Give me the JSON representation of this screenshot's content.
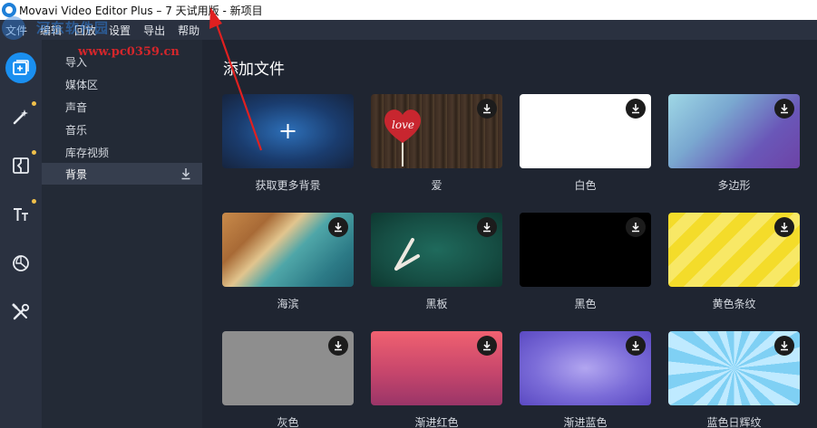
{
  "window": {
    "title": "Movavi Video Editor Plus – 7 天试用版 - 新项目"
  },
  "menu": {
    "items": [
      "文件",
      "编辑",
      "回放",
      "设置",
      "导出",
      "帮助"
    ]
  },
  "watermark": {
    "name": "河东软件园",
    "url": "www.pc0359.cn"
  },
  "rail": {
    "items": [
      {
        "icon": "add-media-icon",
        "active": true
      },
      {
        "icon": "magic-wand-icon",
        "dot": true
      },
      {
        "icon": "transitions-icon",
        "dot": true
      },
      {
        "icon": "titles-icon",
        "dot": true
      },
      {
        "icon": "stickers-icon"
      },
      {
        "icon": "tools-icon"
      }
    ]
  },
  "categories": {
    "items": [
      "导入",
      "媒体区",
      "声音",
      "音乐",
      "库存视频",
      "背景"
    ],
    "selected": "背景"
  },
  "main": {
    "title": "添加文件",
    "tiles": [
      {
        "label": "获取更多背景",
        "thumb": "more"
      },
      {
        "label": "爱",
        "thumb": "love"
      },
      {
        "label": "白色",
        "thumb": "white"
      },
      {
        "label": "多边形",
        "thumb": "poly"
      },
      {
        "label": "海滨",
        "thumb": "beach"
      },
      {
        "label": "黑板",
        "thumb": "chalk"
      },
      {
        "label": "黑色",
        "thumb": "black"
      },
      {
        "label": "黄色条纹",
        "thumb": "yellow"
      },
      {
        "label": "灰色",
        "thumb": "gray"
      },
      {
        "label": "渐进红色",
        "thumb": "red"
      },
      {
        "label": "渐进蓝色",
        "thumb": "blue"
      },
      {
        "label": "蓝色日辉纹",
        "thumb": "rays"
      }
    ],
    "love_text": "love"
  },
  "colors": {
    "accent": "#1a8ff0",
    "annotation_arrow": "#e02020",
    "rail_dot": "#f0c04a"
  }
}
